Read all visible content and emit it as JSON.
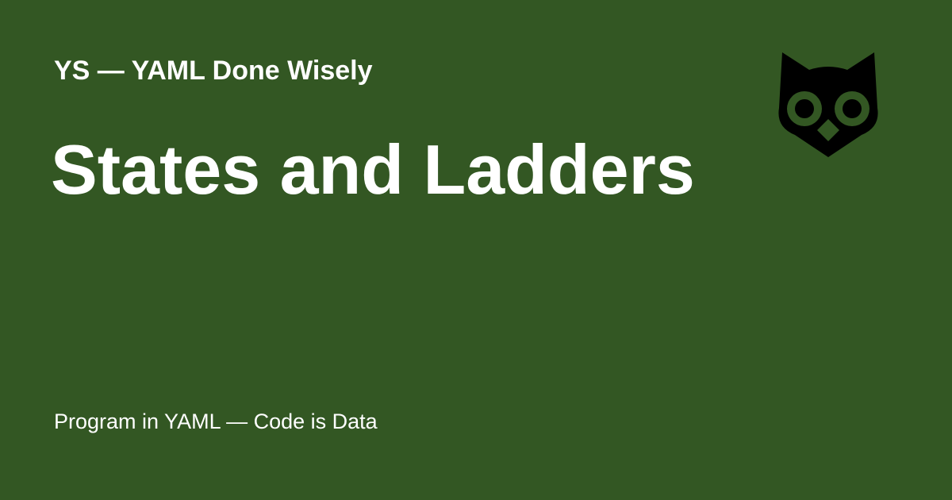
{
  "card": {
    "site_name": "YS — YAML Done Wisely",
    "title": "States and Ladders",
    "tagline": "Program in YAML — Code is Data",
    "logo_icon": "owl-icon",
    "background_color": "#335723",
    "text_color": "#ffffff",
    "logo_color": "#000000"
  }
}
